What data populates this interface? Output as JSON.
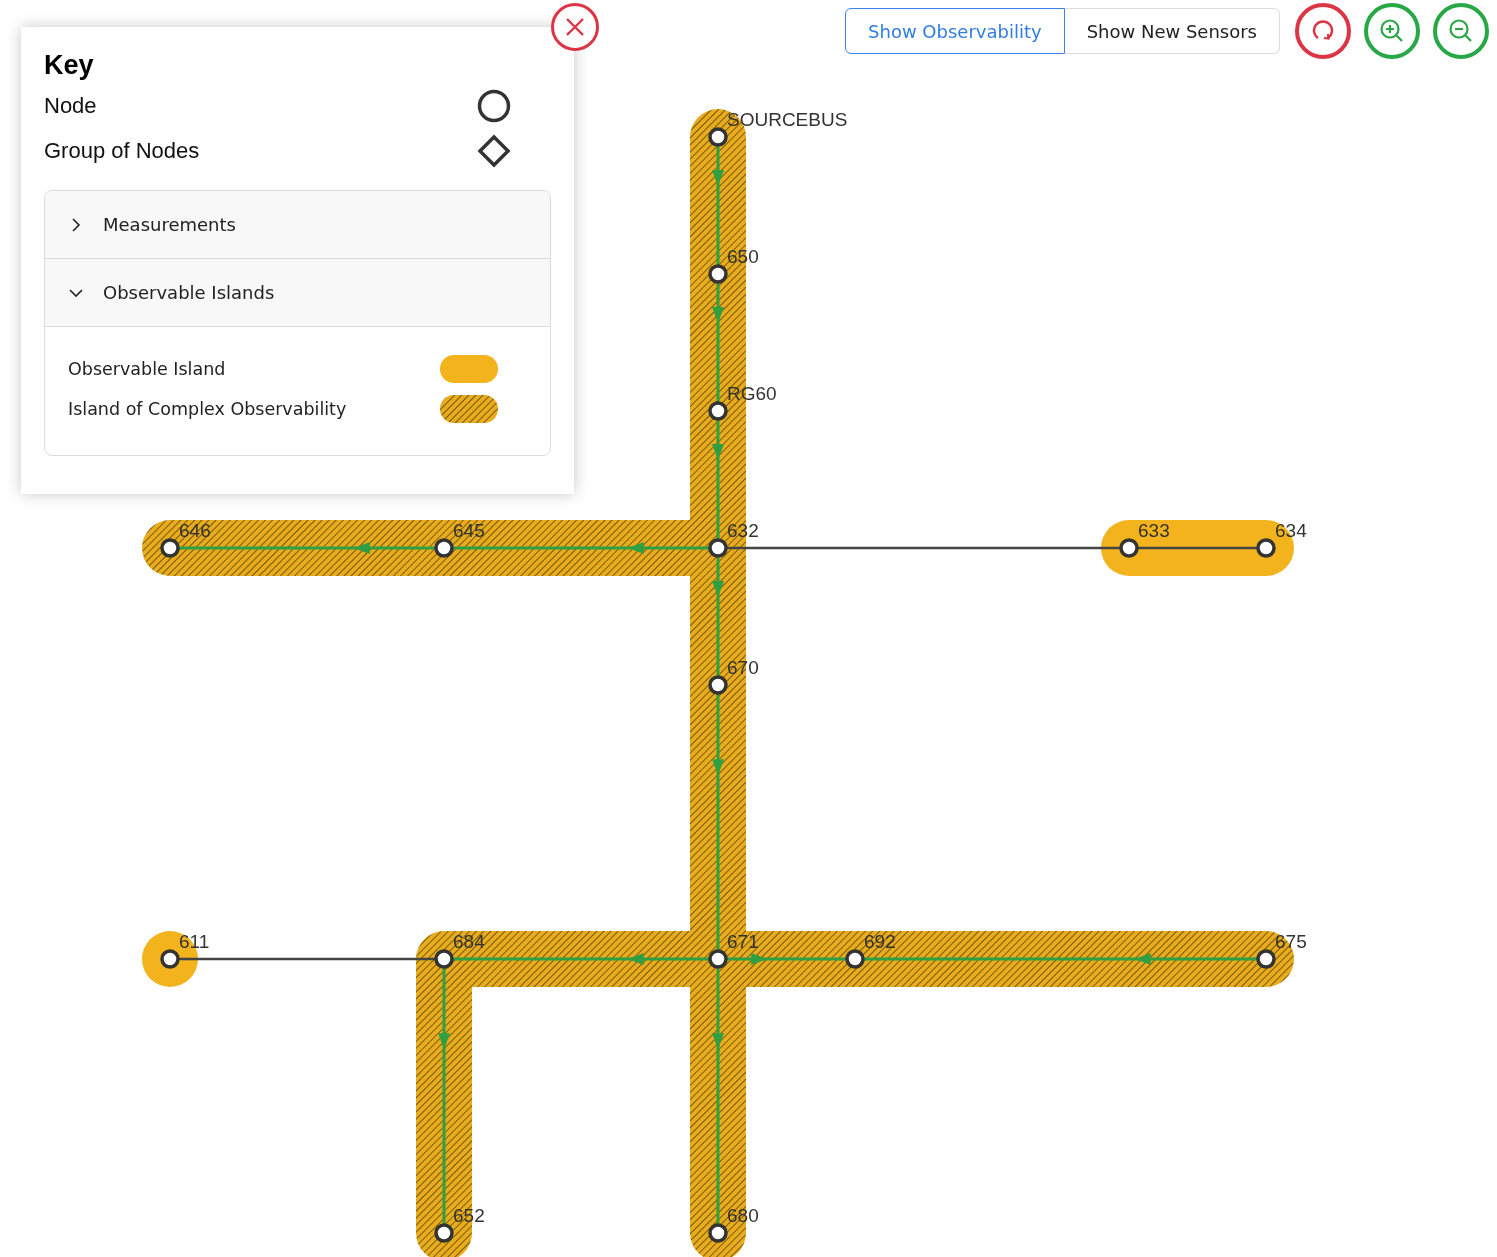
{
  "key": {
    "title": "Key",
    "items": [
      {
        "label": "Node",
        "kind": "node"
      },
      {
        "label": "Group of Nodes",
        "kind": "group"
      }
    ],
    "sections": [
      {
        "title": "Measurements",
        "expanded": false
      },
      {
        "title": "Observable Islands",
        "expanded": true,
        "items": [
          {
            "label": "Observable Island",
            "kind": "observable"
          },
          {
            "label": "Island of Complex Observability",
            "kind": "complex"
          }
        ]
      }
    ]
  },
  "toolbar": {
    "toggles": [
      {
        "label": "Show Observability",
        "selected": true
      },
      {
        "label": "Show New Sensors",
        "selected": false
      }
    ],
    "icon_buttons": [
      {
        "kind": "reset"
      },
      {
        "kind": "zoom_in"
      },
      {
        "kind": "zoom_out"
      }
    ]
  },
  "graph": {
    "nodes": [
      {
        "label": "SOURCEBUS"
      },
      {
        "label": "650"
      },
      {
        "label": "RG60"
      },
      {
        "label": "646"
      },
      {
        "label": "645"
      },
      {
        "label": "632"
      },
      {
        "label": "633"
      },
      {
        "label": "634"
      },
      {
        "label": "670"
      },
      {
        "label": "611"
      },
      {
        "label": "684"
      },
      {
        "label": "671"
      },
      {
        "label": "692"
      },
      {
        "label": "675"
      },
      {
        "label": "652"
      },
      {
        "label": "680"
      }
    ],
    "islands": [
      {
        "kind": "complex"
      },
      {
        "kind": "observable"
      },
      {
        "kind": "observable"
      }
    ],
    "edges": [
      {
        "kind": "flow"
      },
      {
        "kind": "flow"
      },
      {
        "kind": "flow"
      },
      {
        "kind": "flow"
      },
      {
        "kind": "flow"
      },
      {
        "kind": "line"
      },
      {
        "kind": "line"
      },
      {
        "kind": "flow"
      },
      {
        "kind": "flow"
      },
      {
        "kind": "flow"
      },
      {
        "kind": "line"
      },
      {
        "kind": "flow"
      },
      {
        "kind": "flow"
      },
      {
        "kind": "flow"
      },
      {
        "kind": "flow"
      }
    ]
  }
}
